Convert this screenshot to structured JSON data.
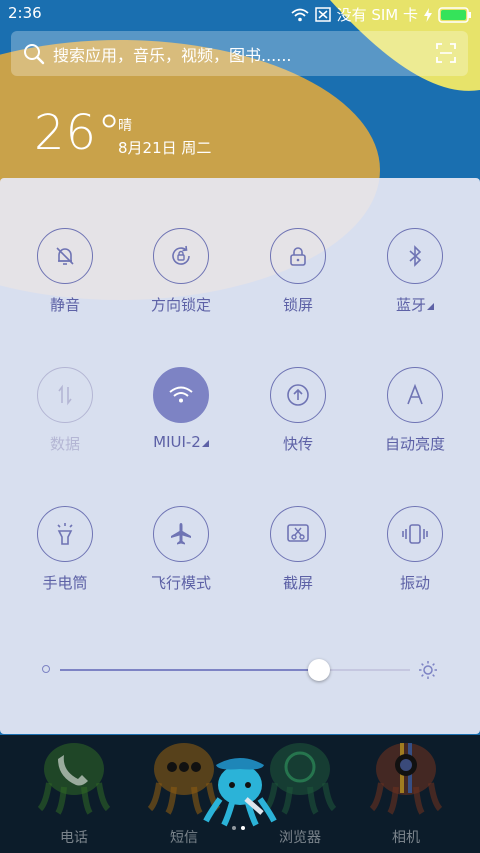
{
  "status_bar": {
    "time": "2:36",
    "sim_text": "没有 SIM 卡",
    "icons": [
      "wifi-icon",
      "sim-missing-icon",
      "charging-icon",
      "battery-icon"
    ]
  },
  "search": {
    "placeholder": "搜索应用，音乐，视频，图书......",
    "left_icon": "search-icon",
    "right_icon": "scan-icon"
  },
  "weather": {
    "temperature": "26°",
    "condition": "晴",
    "date": "8月21日 周二"
  },
  "control_center": {
    "tiles": [
      {
        "label": "静音",
        "icon": "mute-bell-icon",
        "state": "off"
      },
      {
        "label": "方向锁定",
        "icon": "rotation-lock-icon",
        "state": "off"
      },
      {
        "label": "锁屏",
        "icon": "lock-icon",
        "state": "off"
      },
      {
        "label": "蓝牙",
        "icon": "bluetooth-icon",
        "state": "off",
        "expandable": true
      },
      {
        "label": "数据",
        "icon": "mobile-data-icon",
        "state": "disabled"
      },
      {
        "label": "MIUI-2",
        "icon": "wifi-icon",
        "state": "on",
        "expandable": true
      },
      {
        "label": "快传",
        "icon": "share-transfer-icon",
        "state": "off"
      },
      {
        "label": "自动亮度",
        "icon": "auto-brightness-icon",
        "state": "off"
      },
      {
        "label": "手电筒",
        "icon": "flashlight-icon",
        "state": "off"
      },
      {
        "label": "飞行模式",
        "icon": "airplane-icon",
        "state": "off"
      },
      {
        "label": "截屏",
        "icon": "screenshot-icon",
        "state": "off"
      },
      {
        "label": "振动",
        "icon": "vibrate-icon",
        "state": "off"
      }
    ],
    "brightness": {
      "level": 0.74,
      "min_icon": "brightness-low-icon",
      "max_icon": "brightness-high-icon"
    },
    "colors": {
      "accent": "#7d83c4",
      "label": "#5d61a6",
      "disabled": "#b4b6d4"
    }
  },
  "dock": {
    "apps": [
      {
        "label": "电话",
        "icon": "phone-app-icon"
      },
      {
        "label": "短信",
        "icon": "messages-app-icon"
      },
      {
        "label": "浏览器",
        "icon": "browser-app-icon"
      },
      {
        "label": "相机",
        "icon": "camera-app-icon"
      }
    ],
    "floating_icon": "cleaner-octopus-icon",
    "page_indicator": {
      "count": 2,
      "active": 2
    }
  }
}
